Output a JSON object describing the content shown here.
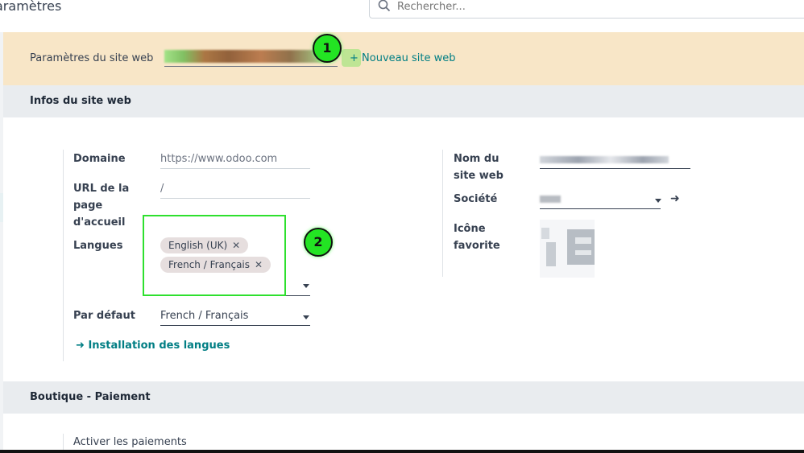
{
  "header": {
    "app_title": "aramètres",
    "search_placeholder": "Rechercher..."
  },
  "banner": {
    "label": "Paramètres du site web",
    "new_site_label": "+ Nouveau site web"
  },
  "sections": {
    "site_info": "Infos du site web",
    "shop_payment": "Boutique - Paiement"
  },
  "left_fields": {
    "domain_label": "Domaine",
    "domain_placeholder": "https://www.odoo.com",
    "home_url_label_1": "URL de la",
    "home_url_label_2": "page",
    "home_url_label_3": "d'accueil",
    "home_url_value": "/",
    "languages_label": "Langues",
    "languages": [
      "English (UK)",
      "French / Français"
    ],
    "default_label": "Par défaut",
    "default_value": "French / Français",
    "install_languages_link": "Installation des langues"
  },
  "right_fields": {
    "site_name_label_1": "Nom du",
    "site_name_label_2": "site web",
    "company_label": "Société",
    "favicon_label_1": "Icône",
    "favicon_label_2": "favorite"
  },
  "payment": {
    "activate_payments_label": "Activer les paiements"
  },
  "annotations": {
    "marker_1": "1",
    "marker_2": "2"
  },
  "icons": [
    "search-icon",
    "close-icon",
    "chevron-down-icon",
    "arrow-right-icon"
  ],
  "colors": {
    "accent": "#017e84",
    "banner_bg": "#f8e6c7",
    "highlight": "#2ee02e"
  }
}
